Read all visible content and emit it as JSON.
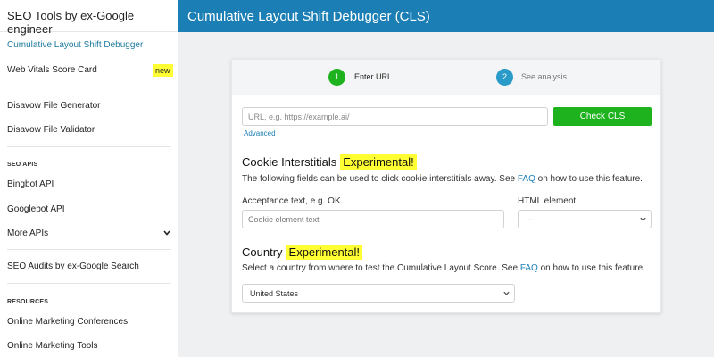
{
  "sidebar": {
    "brand": "SEO Tools by ex-Google engineer",
    "items": [
      {
        "label": "Cumulative Layout Shift Debugger"
      },
      {
        "label": "Web Vitals Score Card",
        "badge": "new"
      },
      {
        "label": "Disavow File Generator"
      },
      {
        "label": "Disavow File Validator"
      },
      {
        "label": "Bingbot API"
      },
      {
        "label": "Googlebot API"
      },
      {
        "label": "More APIs"
      },
      {
        "label": "SEO Audits by ex-Google Search"
      },
      {
        "label": "Online Marketing Conferences"
      },
      {
        "label": "Online Marketing Tools"
      }
    ],
    "sections": {
      "seo_apis": "SEO APIS",
      "resources": "RESOURCES"
    }
  },
  "header": {
    "title": "Cumulative Layout Shift Debugger (CLS)"
  },
  "steps": [
    {
      "number": "1",
      "label": "Enter URL"
    },
    {
      "number": "2",
      "label": "See analysis"
    }
  ],
  "form": {
    "url_placeholder": "URL, e.g. https://example.ai/",
    "check_button": "Check CLS",
    "advanced_link": "Advanced",
    "cookie": {
      "title": "Cookie Interstitials",
      "tag": "Experimental!",
      "desc_pre": "The following fields can be used to click cookie interstitials away. See ",
      "faq": "FAQ",
      "desc_post": " on how to use this feature.",
      "acceptance_label": "Acceptance text, e.g. OK",
      "element_placeholder": "Cookie element text",
      "html_element_label": "HTML element",
      "html_element_value": "---"
    },
    "country": {
      "title": "Country",
      "tag": "Experimental!",
      "desc_pre": "Select a country from where to test the Cumulative Layout Score. See ",
      "faq": "FAQ",
      "desc_post": " on how to use this feature.",
      "value": "United States"
    }
  },
  "colors": {
    "header_blue": "#1b7fb5",
    "step_active": "#1eb31e",
    "step_inactive": "#2a9bc8",
    "highlight": "#ffff33"
  }
}
